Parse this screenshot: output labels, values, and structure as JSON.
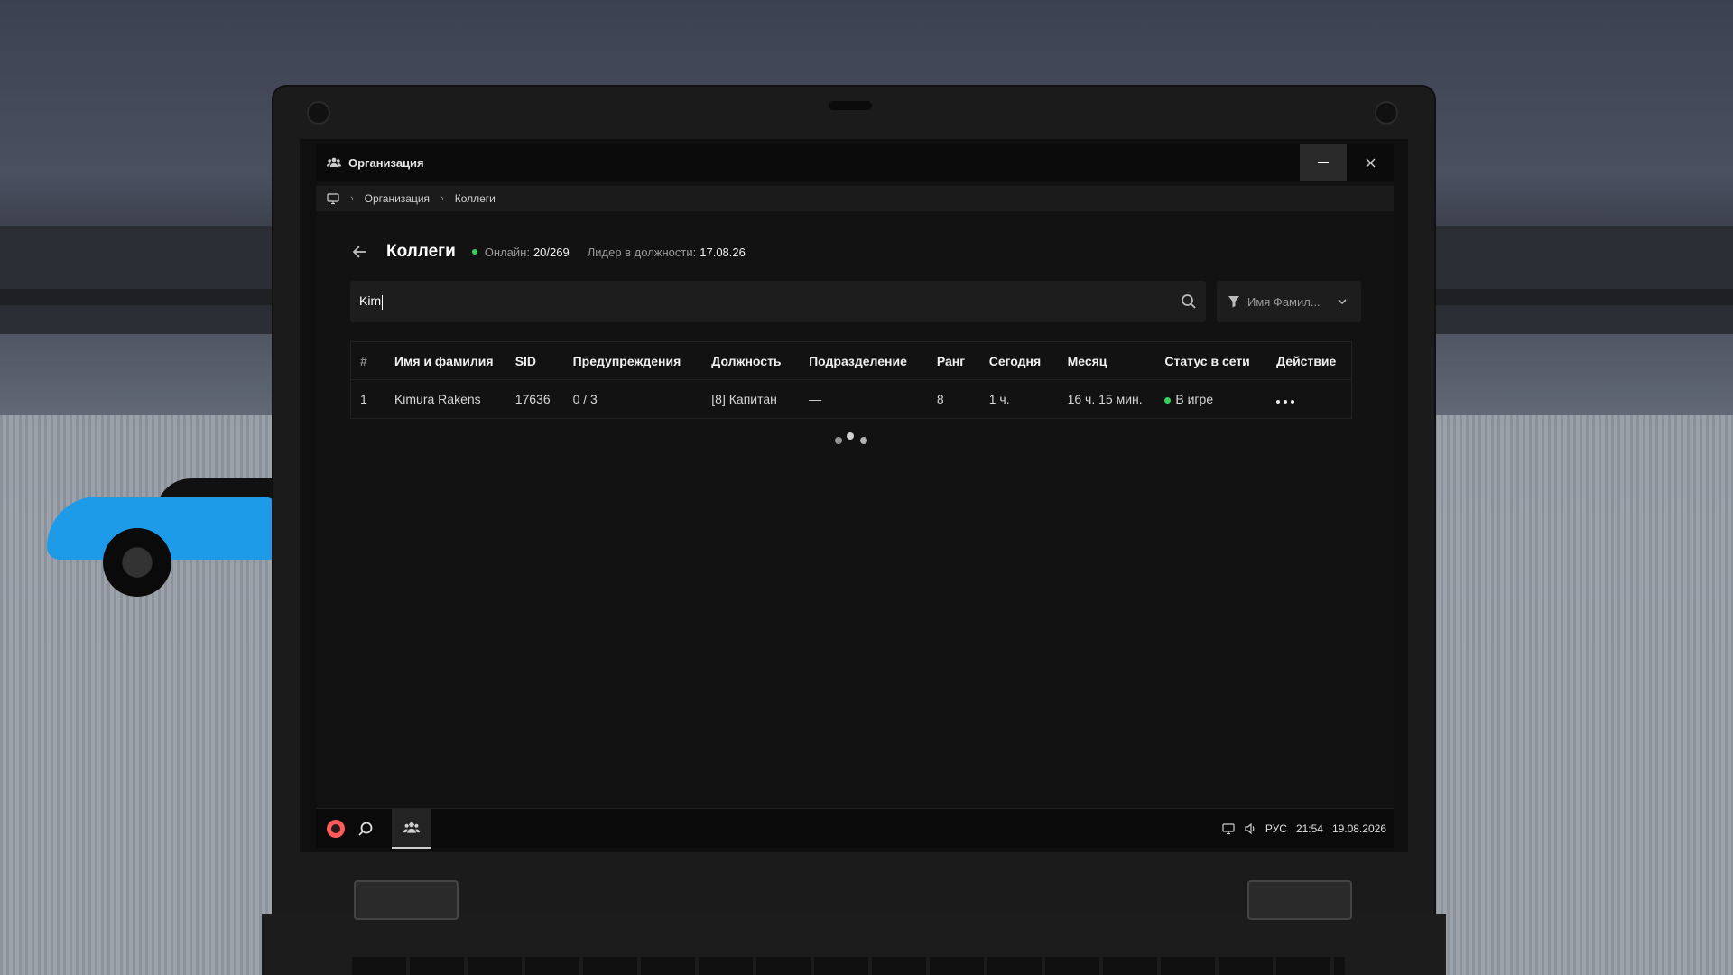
{
  "window": {
    "title": "Организация"
  },
  "breadcrumb": {
    "items": [
      "Организация",
      "Коллеги"
    ]
  },
  "header": {
    "title": "Коллеги",
    "online_label": "Онлайн:",
    "online_value": "20/269",
    "leader_label": "Лидер в должности:",
    "leader_value": "17.08.26"
  },
  "search": {
    "value": "Kim"
  },
  "filter": {
    "selected": "Имя Фамил..."
  },
  "table": {
    "columns": [
      "#",
      "Имя и фамилия",
      "SID",
      "Предупреждения",
      "Должность",
      "Подразделение",
      "Ранг",
      "Сегодня",
      "Месяц",
      "Статус в сети",
      "Действие"
    ],
    "rows": [
      {
        "num": "1",
        "name": "Kimura Rakens",
        "sid": "17636",
        "warnings": "0 / 3",
        "position": "[8] Капитан",
        "division": "—",
        "rank": "8",
        "today": "1 ч.",
        "month": "16 ч. 15 мин.",
        "status": "В игре"
      }
    ]
  },
  "taskbar": {
    "lang": "РУС",
    "time": "21:54",
    "date": "19.08.2026"
  },
  "colors": {
    "online": "#35d15b",
    "window_bg": "#121212",
    "accent_logo": "#ff5a5a"
  },
  "icons": [
    "people-icon",
    "minimize-icon",
    "close-icon",
    "monitor-icon",
    "back-arrow-icon",
    "search-icon",
    "filter-icon",
    "chevron-down-icon",
    "more-icon",
    "app-logo-icon",
    "volume-icon"
  ]
}
